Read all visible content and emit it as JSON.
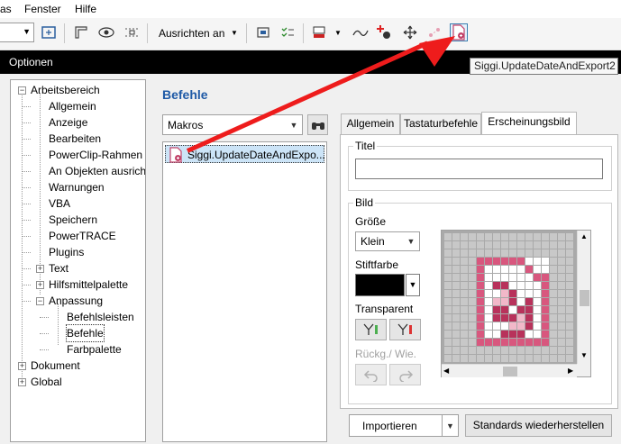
{
  "menubar": {
    "items": [
      "as",
      "Fenster",
      "Hilfe"
    ]
  },
  "toolbar": {
    "align_label": "Ausrichten an"
  },
  "dialog": {
    "title": "Optionen"
  },
  "tooltip": {
    "text": "Siggi.UpdateDateAndExport2"
  },
  "tree": {
    "items": [
      {
        "label": "Arbeitsbereich",
        "expander": "−"
      },
      {
        "label": "Allgemein"
      },
      {
        "label": "Anzeige"
      },
      {
        "label": "Bearbeiten"
      },
      {
        "label": "PowerClip-Rahmen"
      },
      {
        "label": "An Objekten ausrich"
      },
      {
        "label": "Warnungen"
      },
      {
        "label": "VBA"
      },
      {
        "label": "Speichern"
      },
      {
        "label": "PowerTRACE"
      },
      {
        "label": "Plugins"
      },
      {
        "label": "Text",
        "expander": "+"
      },
      {
        "label": "Hilfsmittelpalette",
        "expander": "+"
      },
      {
        "label": "Anpassung",
        "expander": "−"
      },
      {
        "label": "Befehlsleisten"
      },
      {
        "label": "Befehle"
      },
      {
        "label": "Farbpalette"
      },
      {
        "label": "Dokument",
        "expander": "+"
      },
      {
        "label": "Global",
        "expander": "+"
      }
    ]
  },
  "befehle": {
    "title": "Befehle",
    "category_value": "Makros",
    "command_item": "Siggi.UpdateDateAndExpo..."
  },
  "tabs": [
    "Allgemein",
    "Tastaturbefehle",
    "Erscheinungsbild"
  ],
  "appearance": {
    "title_group": "Titel",
    "title_value": "",
    "image_group": "Bild",
    "size_label": "Größe",
    "size_value": "Klein",
    "pen_color_label": "Stiftfarbe",
    "pen_color": "#000000",
    "transparent_label": "Transparent",
    "undo_label": "Rückg./ Wie."
  },
  "footer": {
    "import_label": "Importieren",
    "reset_label": "Standards wiederherstellen"
  },
  "colors": {
    "accent_title": "#1f5aa6",
    "arrow": "#ee1c1c",
    "icon_pink": "#d8577e",
    "icon_dark_pink": "#b8325b",
    "icon_light_pink": "#f2b8c9"
  }
}
